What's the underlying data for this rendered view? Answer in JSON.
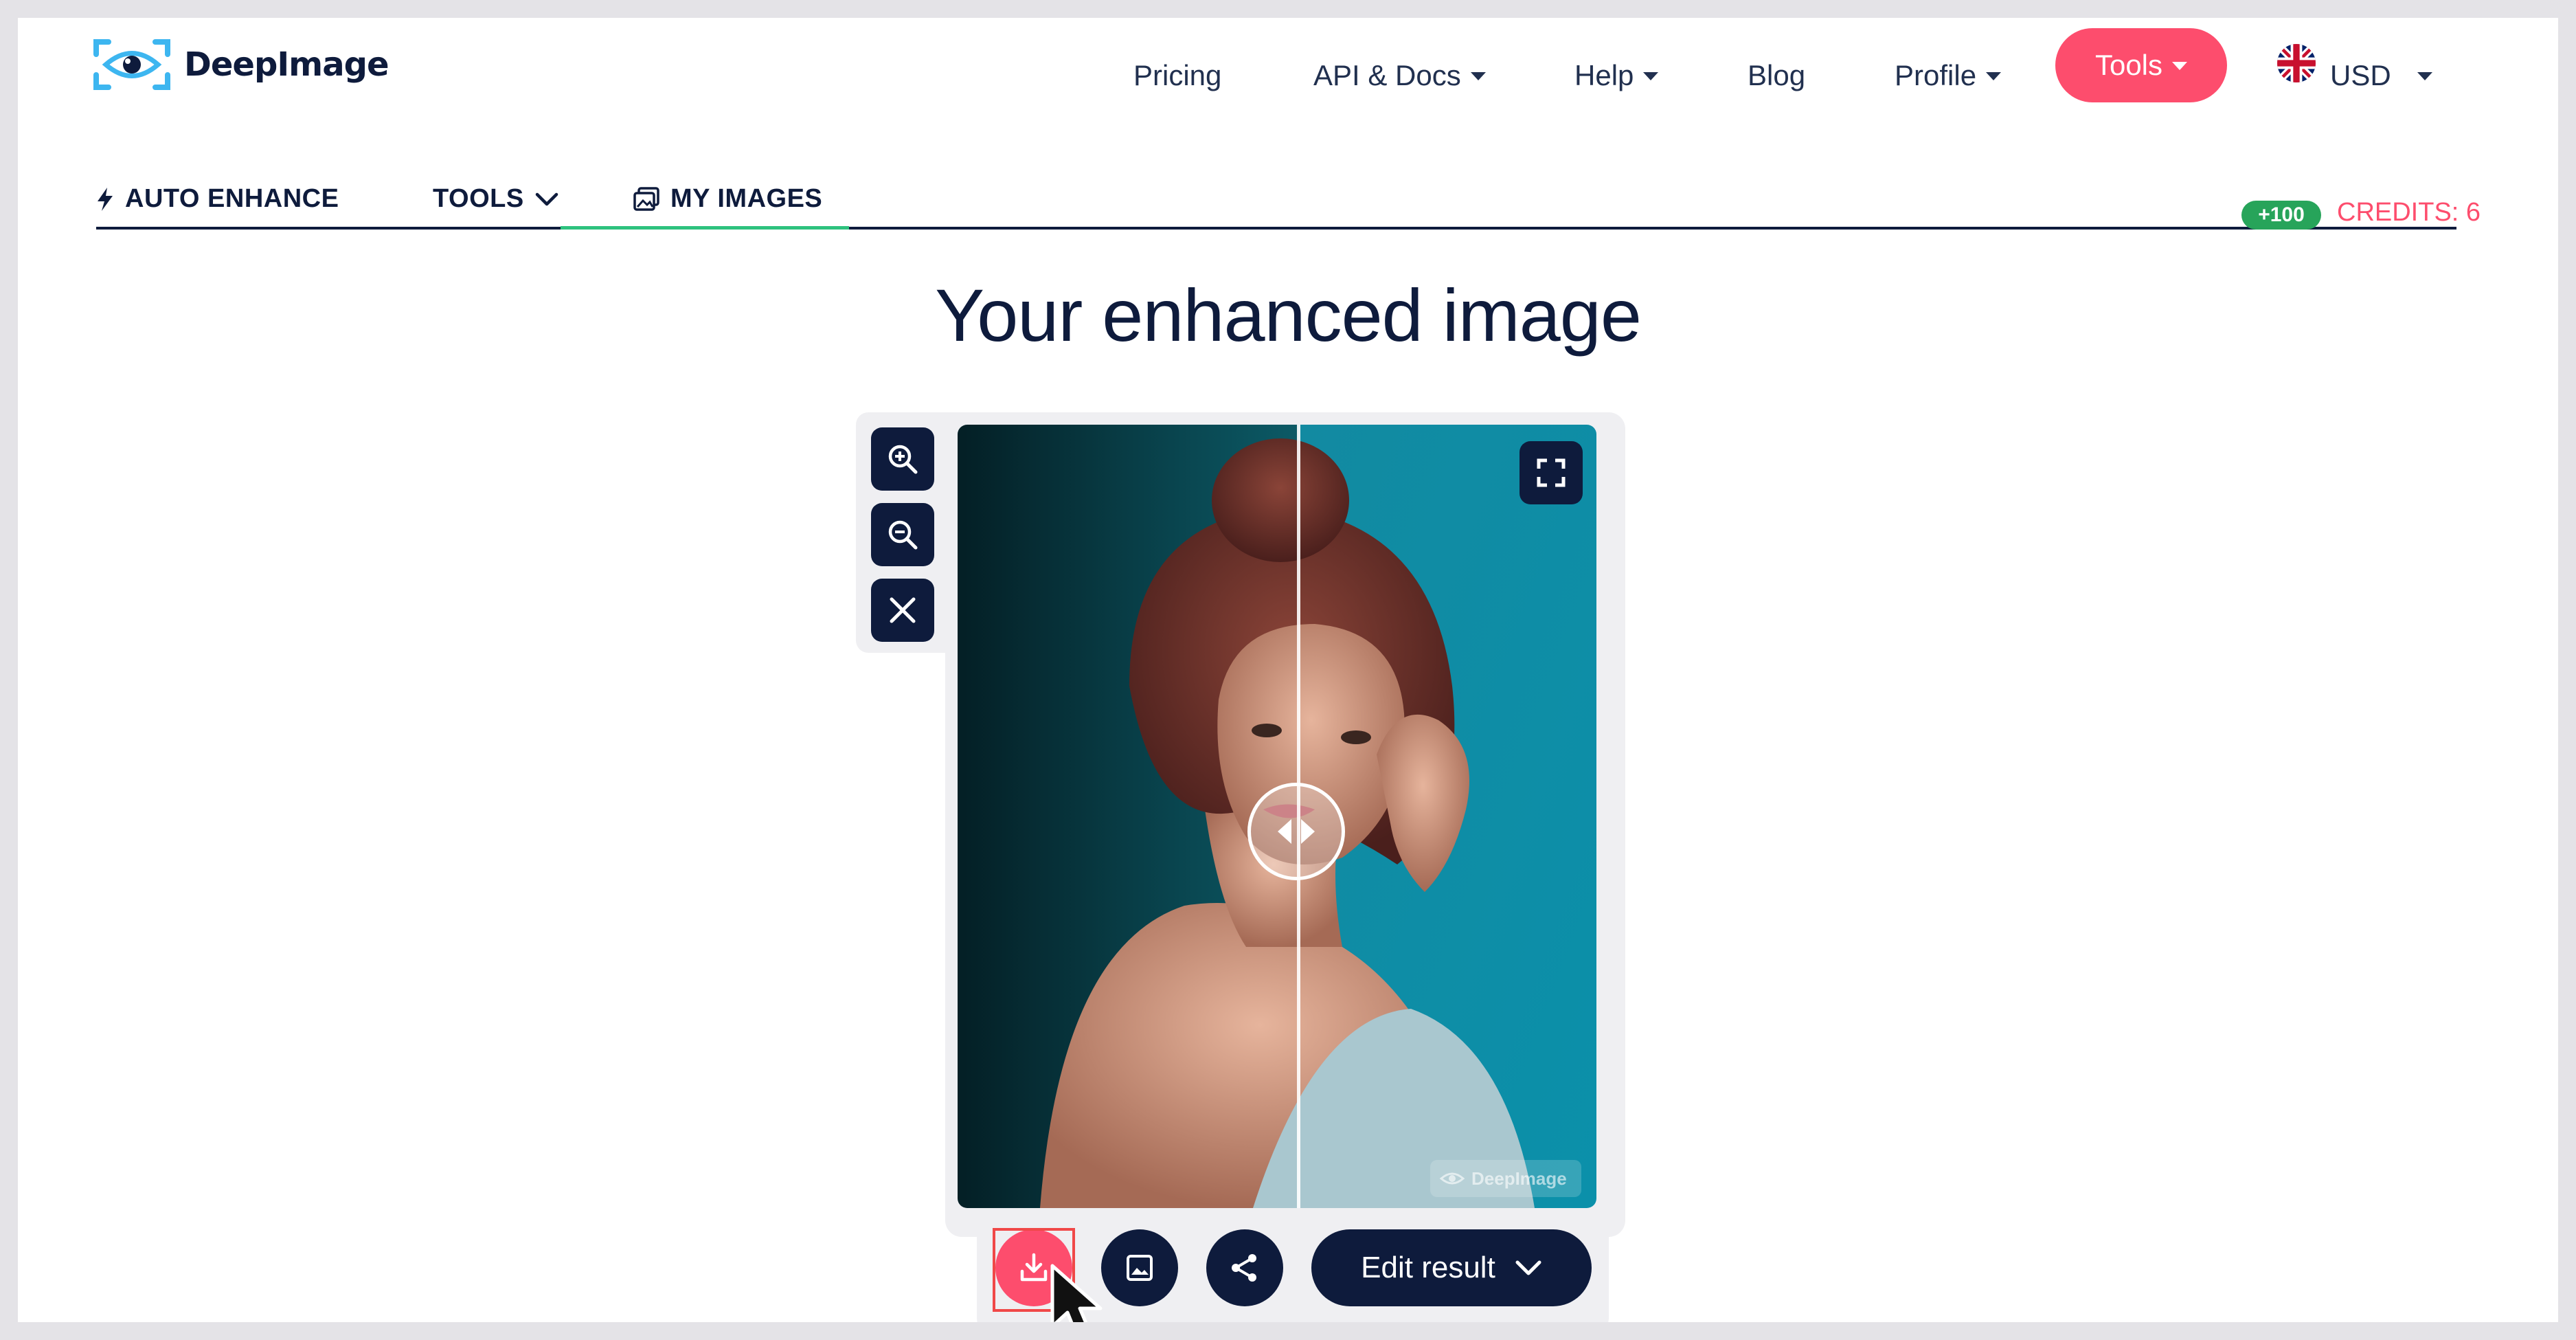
{
  "brand": {
    "name": "DeepImage",
    "accent": "#fd4d6d",
    "navy": "#0e1b3c",
    "green": "#2ec27e"
  },
  "topnav": {
    "pricing": "Pricing",
    "api_docs": "API & Docs",
    "help": "Help",
    "blog": "Blog",
    "profile": "Profile",
    "tools": "Tools",
    "currency": "USD"
  },
  "subnav": {
    "auto_enhance": "AUTO ENHANCE",
    "tools": "TOOLS",
    "my_images": "MY IMAGES",
    "active_tab": "MY IMAGES"
  },
  "credits": {
    "badge": "+100",
    "label": "CREDITS: 6"
  },
  "main": {
    "title": "Your enhanced image"
  },
  "viewer": {
    "watermark": "DeepImage",
    "icons": [
      "zoom-in-icon",
      "zoom-out-icon",
      "close-icon",
      "fullscreen-icon",
      "compare-arrows-icon"
    ]
  },
  "actions": {
    "edit_result": "Edit result",
    "icons": [
      "download-icon",
      "image-icon",
      "share-icon",
      "chevron-down-icon"
    ]
  }
}
